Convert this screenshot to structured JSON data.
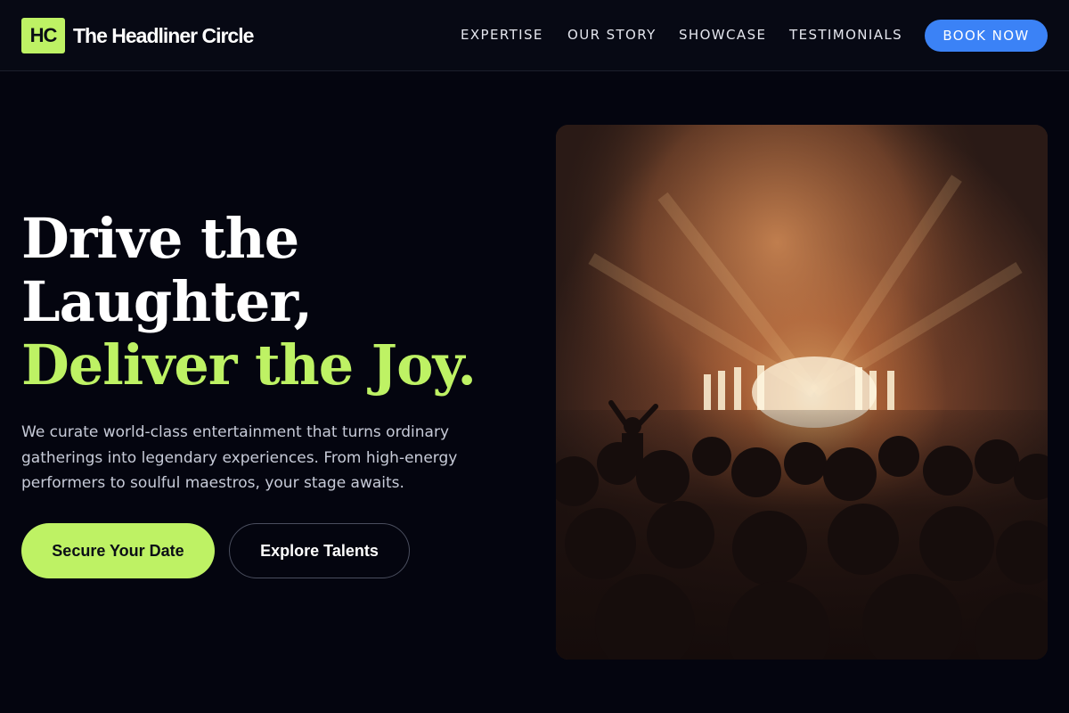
{
  "header": {
    "logo_mark": "HC",
    "brand_name": "The Headliner Circle",
    "nav": [
      "EXPERTISE",
      "OUR STORY",
      "SHOWCASE",
      "TESTIMONIALS"
    ],
    "cta_label": "BOOK NOW"
  },
  "hero": {
    "headline_line1": "Drive the",
    "headline_line2": "Laughter,",
    "headline_accent": "Deliver the Joy.",
    "description": "We curate world-class entertainment that turns ordinary gatherings into legendary experiences. From high-energy performers to soulful maestros, your stage awaits.",
    "primary_button": "Secure Your Date",
    "secondary_button": "Explore Talents",
    "image_subject": "concert crowd in front of a lit stage with smoke and spotlights"
  },
  "colors": {
    "background": "#04050f",
    "accent": "#bef264",
    "button_blue": "#3b82f6"
  }
}
